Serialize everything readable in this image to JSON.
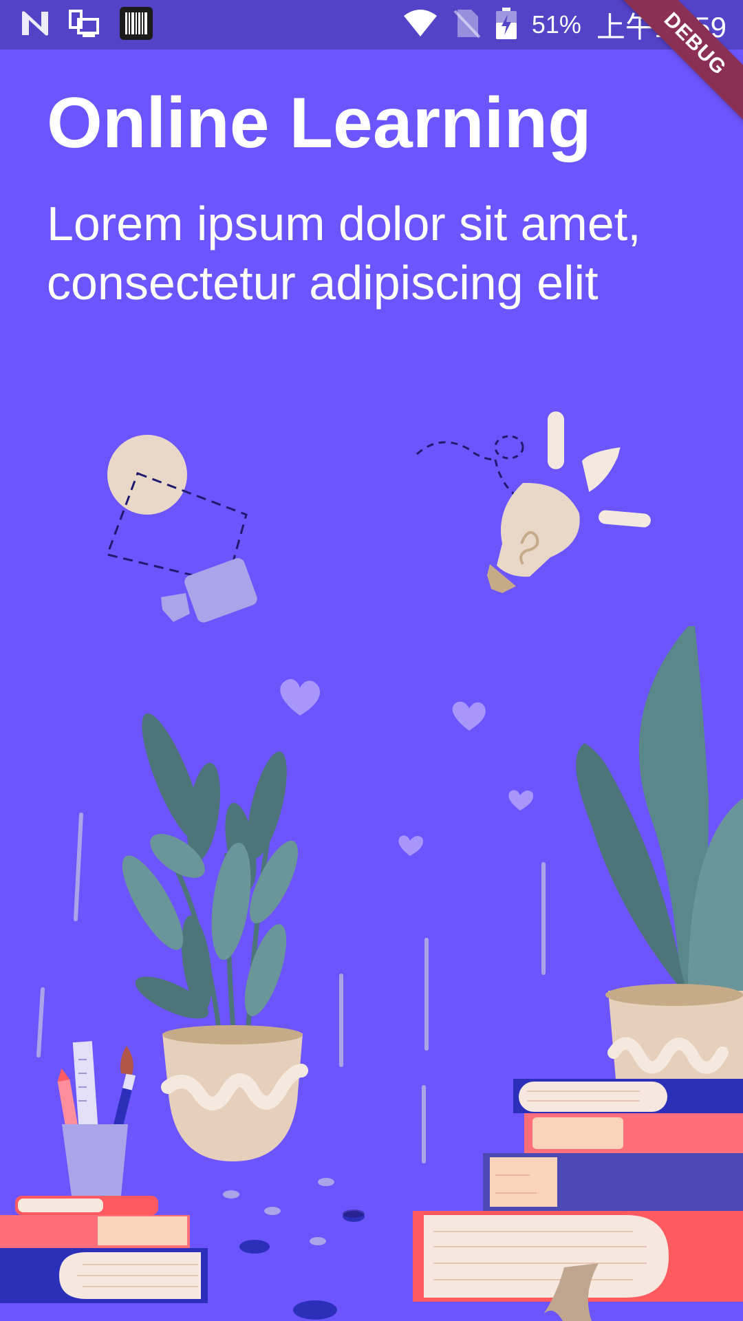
{
  "status_bar": {
    "battery_percent": "51%",
    "time": "上午10:59",
    "icons": [
      "n-logo-icon",
      "screen-cast-icon",
      "barcode-icon",
      "wifi-icon",
      "no-sim-icon",
      "battery-charging-icon"
    ]
  },
  "debug_banner": "DEBUG",
  "onboarding": {
    "title": "Online Learning",
    "subtitle": "Lorem ipsum dolor sit amet, consectetur adipiscing elit"
  },
  "colors": {
    "background": "#6c55fd",
    "status_bar": "#5343c6",
    "text": "#ffffff",
    "beige": "#e9d8c8",
    "lavender": "#aaa5e9",
    "leaf_dark": "#4d7478",
    "leaf_light": "#6a9699",
    "book_coral": "#ff5a5f",
    "book_navy": "#2c2fba"
  }
}
